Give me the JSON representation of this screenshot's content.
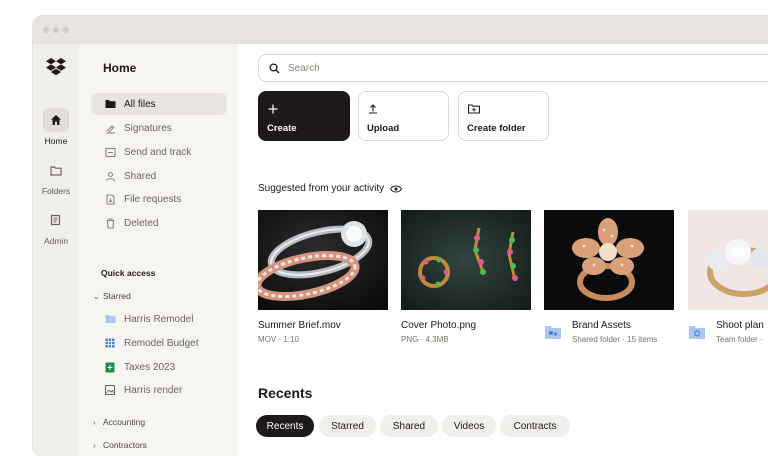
{
  "rail": {
    "items": [
      {
        "label": "Home",
        "icon": "home-icon"
      },
      {
        "label": "Folders",
        "icon": "folder-icon"
      },
      {
        "label": "Admin",
        "icon": "admin-icon"
      }
    ]
  },
  "sidebar": {
    "title": "Home",
    "nav": [
      {
        "label": "All files",
        "icon": "folder-icon"
      },
      {
        "label": "Signatures",
        "icon": "signature-icon"
      },
      {
        "label": "Send and track",
        "icon": "send-icon"
      },
      {
        "label": "Shared",
        "icon": "shared-icon"
      },
      {
        "label": "File requests",
        "icon": "file-request-icon"
      },
      {
        "label": "Deleted",
        "icon": "trash-icon"
      }
    ],
    "quick_access": "Quick access",
    "starred": "Starred",
    "starred_items": [
      {
        "label": "Harris Remodel",
        "icon": "folder-icon",
        "color": "#a9c6ee"
      },
      {
        "label": "Remodel Budget",
        "icon": "grid-file-icon",
        "color": "#4a7fd6"
      },
      {
        "label": "Taxes 2023",
        "icon": "spreadsheet-icon",
        "color": "#1f8a4c"
      },
      {
        "label": "Harris render",
        "icon": "image-file-icon",
        "color": "#6b6560"
      }
    ],
    "tree": [
      {
        "label": "Accounting"
      },
      {
        "label": "Contractors"
      }
    ]
  },
  "main": {
    "search_placeholder": "Search",
    "actions": [
      {
        "label": "Create",
        "icon": "plus-icon"
      },
      {
        "label": "Upload",
        "icon": "upload-icon"
      },
      {
        "label": "Create folder",
        "icon": "new-folder-icon"
      }
    ],
    "suggested_title": "Suggested from your activity",
    "cards": [
      {
        "name": "Summer Brief.mov",
        "meta": "MOV · 1:10"
      },
      {
        "name": "Cover Photo.png",
        "meta": "PNG · 4.3MB"
      },
      {
        "name": "Brand Assets",
        "meta": "Shared folder · 15 items"
      },
      {
        "name": "Shoot plan",
        "meta": "Team folder ·"
      }
    ],
    "recents_title": "Recents",
    "chips": [
      "Recents",
      "Starred",
      "Shared",
      "Videos",
      "Contracts"
    ]
  },
  "colors": {
    "accent_dark": "#1e1919",
    "sidebar_bg": "#f7f5f2",
    "folder_blue": "#a9c6ee"
  }
}
